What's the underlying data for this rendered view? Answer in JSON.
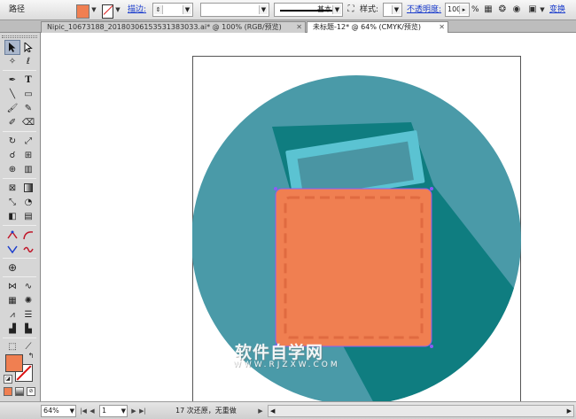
{
  "colors": {
    "circle": "#4a9aa8",
    "long_shadow": "#0f7d80",
    "wallet": "#f07f51",
    "wallet_stitch": "#e06a40",
    "card": "#5bc3d2",
    "card_inner": "#4a95a3",
    "selection": "#8b5cf6"
  },
  "control_bar": {
    "object_type": "路径",
    "stroke_label": "描边:",
    "stroke_profile": "基本",
    "style_label": "样式:",
    "opacity_label": "不透明度:",
    "opacity_value": "100",
    "opacity_unit": "%",
    "transform_label": "变换",
    "stroke_weight": ""
  },
  "tabs": [
    {
      "label": "Nipic_10673188_20180306153531383033.ai* @ 100% (RGB/预览)",
      "active": false
    },
    {
      "label": "未标题-12* @ 64% (CMYK/预览)",
      "active": true
    }
  ],
  "tools": {
    "icons": [
      "selection-tool",
      "direct-selection-tool",
      "magic-wand-tool",
      "lasso-tool",
      "pen-tool",
      "type-tool",
      "line-tool",
      "rectangle-tool",
      "paintbrush-tool",
      "pencil-tool",
      "blob-brush-tool",
      "eraser-tool",
      "rotate-tool",
      "scale-tool",
      "warp-tool",
      "free-transform-tool",
      "shape-builder-tool",
      "perspective-grid-tool",
      "mesh-tool",
      "gradient-tool",
      "eyedropper-tool",
      "blend-tool",
      "symbol-sprayer-tool",
      "column-graph-tool",
      "artboard-tool",
      "slice-tool",
      "hand-tool",
      "zoom-tool"
    ],
    "fill_color": "#f07f51"
  },
  "status_bar": {
    "zoom": "64%",
    "page": "1",
    "status_text": "17 次还原，无重做"
  },
  "watermark": {
    "title": "软件自学网",
    "url": "WWW.RJZXW.COM"
  }
}
